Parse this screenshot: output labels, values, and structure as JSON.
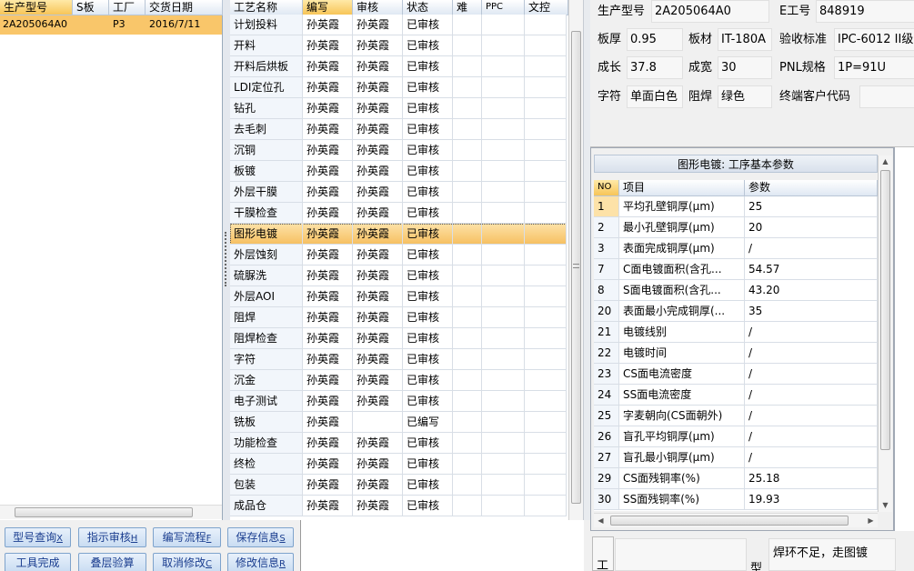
{
  "left_grid": {
    "columns": [
      "生产型号",
      "S板",
      "工厂",
      "交货日期"
    ],
    "rows": [
      {
        "model": "2A205064A0",
        "sb": "",
        "factory": "P3",
        "date": "2016/7/11"
      }
    ]
  },
  "process_grid": {
    "columns": [
      "工艺名称",
      "编写",
      "审核",
      "状态",
      "难",
      "PPC",
      "文控"
    ],
    "selected_index": 10,
    "rows": [
      [
        "计划投料",
        "孙英霞",
        "孙英霞",
        "已审核"
      ],
      [
        "开料",
        "孙英霞",
        "孙英霞",
        "已审核"
      ],
      [
        "开料后烘板",
        "孙英霞",
        "孙英霞",
        "已审核"
      ],
      [
        "LDI定位孔",
        "孙英霞",
        "孙英霞",
        "已审核"
      ],
      [
        "钻孔",
        "孙英霞",
        "孙英霞",
        "已审核"
      ],
      [
        "去毛刺",
        "孙英霞",
        "孙英霞",
        "已审核"
      ],
      [
        "沉铜",
        "孙英霞",
        "孙英霞",
        "已审核"
      ],
      [
        "板镀",
        "孙英霞",
        "孙英霞",
        "已审核"
      ],
      [
        "外层干膜",
        "孙英霞",
        "孙英霞",
        "已审核"
      ],
      [
        "干膜检查",
        "孙英霞",
        "孙英霞",
        "已审核"
      ],
      [
        "图形电镀",
        "孙英霞",
        "孙英霞",
        "已审核"
      ],
      [
        "外层蚀刻",
        "孙英霞",
        "孙英霞",
        "已审核"
      ],
      [
        "硫脲洗",
        "孙英霞",
        "孙英霞",
        "已审核"
      ],
      [
        "外层AOI",
        "孙英霞",
        "孙英霞",
        "已审核"
      ],
      [
        "阻焊",
        "孙英霞",
        "孙英霞",
        "已审核"
      ],
      [
        "阻焊检查",
        "孙英霞",
        "孙英霞",
        "已审核"
      ],
      [
        "字符",
        "孙英霞",
        "孙英霞",
        "已审核"
      ],
      [
        "沉金",
        "孙英霞",
        "孙英霞",
        "已审核"
      ],
      [
        "电子测试",
        "孙英霞",
        "孙英霞",
        "已审核"
      ],
      [
        "铣板",
        "孙英霞",
        "",
        "已编写"
      ],
      [
        "功能检查",
        "孙英霞",
        "孙英霞",
        "已审核"
      ],
      [
        "终检",
        "孙英霞",
        "孙英霞",
        "已审核"
      ],
      [
        "包装",
        "孙英霞",
        "孙英霞",
        "已审核"
      ],
      [
        "成品仓",
        "孙英霞",
        "孙英霞",
        "已审核"
      ]
    ]
  },
  "buttons": {
    "row1": [
      {
        "label": "型号查询",
        "key": "X"
      },
      {
        "label": "指示审核",
        "key": "H"
      },
      {
        "label": "编写流程",
        "key": "F"
      },
      {
        "label": "保存信息",
        "key": "S"
      }
    ],
    "row2": [
      {
        "label": "工具完成",
        "key": ""
      },
      {
        "label": "叠层验算",
        "key": ""
      },
      {
        "label": "取消修改",
        "key": "C"
      },
      {
        "label": "修改信息",
        "key": "R"
      }
    ]
  },
  "info": {
    "prod_model_label": "生产型号",
    "prod_model": "2A205064A0",
    "e_no_label": "E工号",
    "e_no": "848919",
    "thickness_label": "板厚",
    "thickness": "0.95",
    "material_label": "板材",
    "material": "IT-180A",
    "standard_label": "验收标准",
    "standard": "IPC-6012 II级",
    "length_label": "成长",
    "length": "37.8",
    "width_label": "成宽",
    "width": "30",
    "pnl_label": "PNL规格",
    "pnl": "1P=91U",
    "char_label": "字符",
    "char": "单面白色",
    "mask_label": "阻焊",
    "mask": "绿色",
    "customer_label": "终端客户代码",
    "customer": ""
  },
  "params": {
    "title": "图形电镀: 工序基本参数",
    "columns": [
      "NO",
      "项目",
      "参数"
    ],
    "rows": [
      [
        "1",
        "平均孔壁铜厚(μm)",
        "25"
      ],
      [
        "2",
        "最小孔壁铜厚(μm)",
        "20"
      ],
      [
        "3",
        "表面完成铜厚(μm)",
        "/"
      ],
      [
        "7",
        "C面电镀面积(含孔...",
        "54.57"
      ],
      [
        "8",
        "S面电镀面积(含孔...",
        "43.20"
      ],
      [
        "20",
        "表面最小完成铜厚(...",
        "35"
      ],
      [
        "21",
        "电镀线别",
        "/"
      ],
      [
        "22",
        "电镀时间",
        "/"
      ],
      [
        "23",
        "CS面电流密度",
        "/"
      ],
      [
        "24",
        "SS面电流密度",
        "/"
      ],
      [
        "25",
        "字麦朝向(CS面朝外)",
        "/"
      ],
      [
        "26",
        "盲孔平均铜厚(μm)",
        "/"
      ],
      [
        "27",
        "盲孔最小铜厚(μm)",
        "/"
      ],
      [
        "29",
        "CS面残铜率(%)",
        "25.18"
      ],
      [
        "30",
        "SS面残铜率(%)",
        "19.93"
      ]
    ]
  },
  "bottom": {
    "label_left": "工",
    "label_mid": "型",
    "note": "焊环不足，走图镀"
  },
  "colors": {
    "selected_row": "#f9c66a",
    "header_bg": "#dfe8f3",
    "button_bg": "#c9dcf2",
    "panel_bg": "#f0f0f0"
  }
}
